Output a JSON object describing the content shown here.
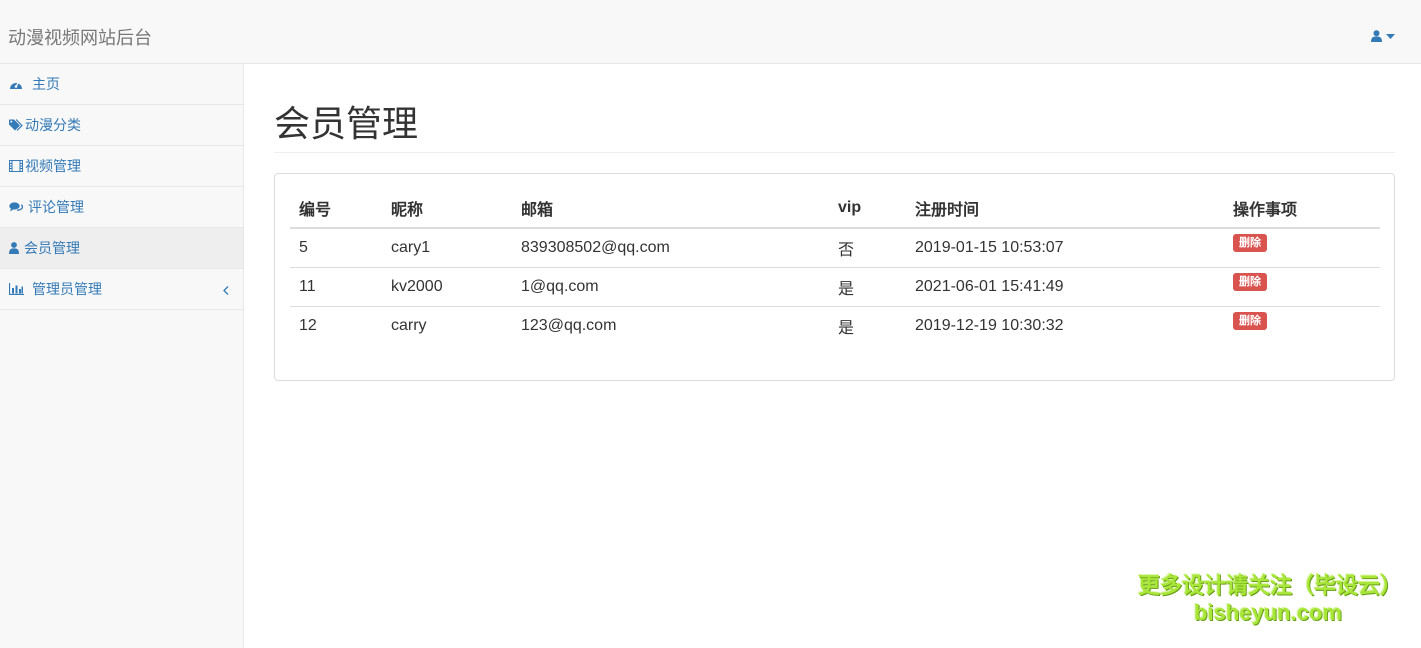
{
  "app": {
    "brand": "动漫视频网站后台"
  },
  "sidebar": {
    "items": [
      {
        "label": "主页",
        "icon": "dashboard-icon"
      },
      {
        "label": "动漫分类",
        "icon": "tags-icon"
      },
      {
        "label": "视频管理",
        "icon": "film-icon"
      },
      {
        "label": "评论管理",
        "icon": "comments-icon"
      },
      {
        "label": "会员管理",
        "icon": "user-icon",
        "active": true
      },
      {
        "label": "管理员管理",
        "icon": "bar-chart-icon",
        "expandable": true
      }
    ]
  },
  "main": {
    "title": "会员管理",
    "table": {
      "headers": [
        "编号",
        "昵称",
        "邮箱",
        "vip",
        "注册时间",
        "操作事项"
      ],
      "rows": [
        {
          "id": "5",
          "nickname": "cary1",
          "email": "839308502@qq.com",
          "vip": "否",
          "registered": "2019-01-15 10:53:07",
          "action": "删除"
        },
        {
          "id": "11",
          "nickname": "kv2000",
          "email": "1@qq.com",
          "vip": "是",
          "registered": "2021-06-01 15:41:49",
          "action": "删除"
        },
        {
          "id": "12",
          "nickname": "carry",
          "email": "123@qq.com",
          "vip": "是",
          "registered": "2019-12-19 10:30:32",
          "action": "删除"
        }
      ]
    }
  },
  "watermark": {
    "line1": "更多设计请关注（毕设云）",
    "line2": "bisheyun.com"
  },
  "colors": {
    "link": "#337ab7",
    "danger": "#d9534f",
    "navbar_bg": "#f8f8f8",
    "watermark": "#a8e63a"
  }
}
